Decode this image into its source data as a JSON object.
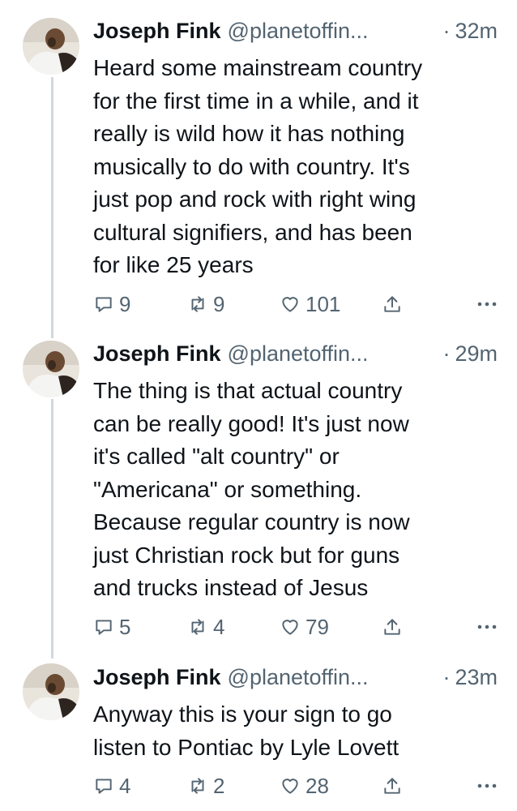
{
  "tweets": [
    {
      "name": "Joseph Fink",
      "handle": "@planetoffin...",
      "dot": "·",
      "time": "32m",
      "text": "Heard some mainstream country\nfor the first time in a while, and it\nreally is wild how it has nothing\nmusically to do with country. It's\njust pop and rock with right wing\ncultural signifiers, and has been\nfor like 25 years",
      "replies": "9",
      "retweets": "9",
      "likes": "101"
    },
    {
      "name": "Joseph Fink",
      "handle": "@planetoffin...",
      "dot": "·",
      "time": "29m",
      "text": "The thing is that actual country\ncan be really good! It's just now\nit's called \"alt country\" or\n\"Americana\" or something.\nBecause regular country is now\njust Christian rock but for guns\nand trucks instead of Jesus",
      "replies": "5",
      "retweets": "4",
      "likes": "79"
    },
    {
      "name": "Joseph Fink",
      "handle": "@planetoffin...",
      "dot": "·",
      "time": "23m",
      "text": "Anyway this is your sign to go\nlisten to Pontiac by Lyle Lovett",
      "replies": "4",
      "retweets": "2",
      "likes": "28"
    }
  ],
  "icons": {
    "reply": "reply-icon",
    "retweet": "retweet-icon",
    "like": "heart-icon",
    "share": "share-icon",
    "more": "more-icon"
  },
  "colors": {
    "text": "#0f1419",
    "secondary": "#536471",
    "thread_line": "#cfd9de"
  }
}
